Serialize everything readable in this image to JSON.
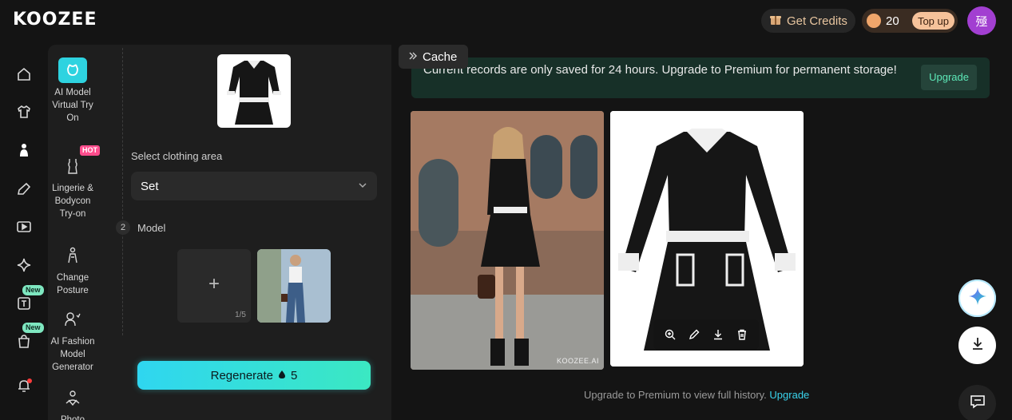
{
  "header": {
    "logo": "KOOZEE",
    "get_credits_label": "Get Credits",
    "credit_count": "20",
    "top_up_label": "Top up",
    "avatar_initial": "殛"
  },
  "rail": {
    "badges": [
      "New",
      "New"
    ]
  },
  "tools": [
    {
      "label": "AI Model Virtual Try On",
      "active": true
    },
    {
      "label": "Lingerie & Bodycon Try-on",
      "badge": "HOT"
    },
    {
      "label": "Change Posture"
    },
    {
      "label": "AI Fashion Model Generator"
    },
    {
      "label": "Photo"
    }
  ],
  "panel": {
    "select_area_label": "Select clothing area",
    "select_value": "Set",
    "step_number": "2",
    "model_label": "Model",
    "add_count": "1/5",
    "regenerate_label": "Regenerate",
    "regenerate_cost": "5"
  },
  "main": {
    "cache_label": "Cache",
    "notice_text": "Current records are only saved for 24 hours. Upgrade to Premium for permanent storage!",
    "upgrade_button": "Upgrade",
    "watermark": "KOOZEE.AI",
    "footer_text": "Upgrade to Premium to view full history.",
    "footer_link": "Upgrade"
  },
  "colors": {
    "accent": "#2ed3e0",
    "notice_bg": "#173028",
    "avatar": "#a23fd1"
  }
}
